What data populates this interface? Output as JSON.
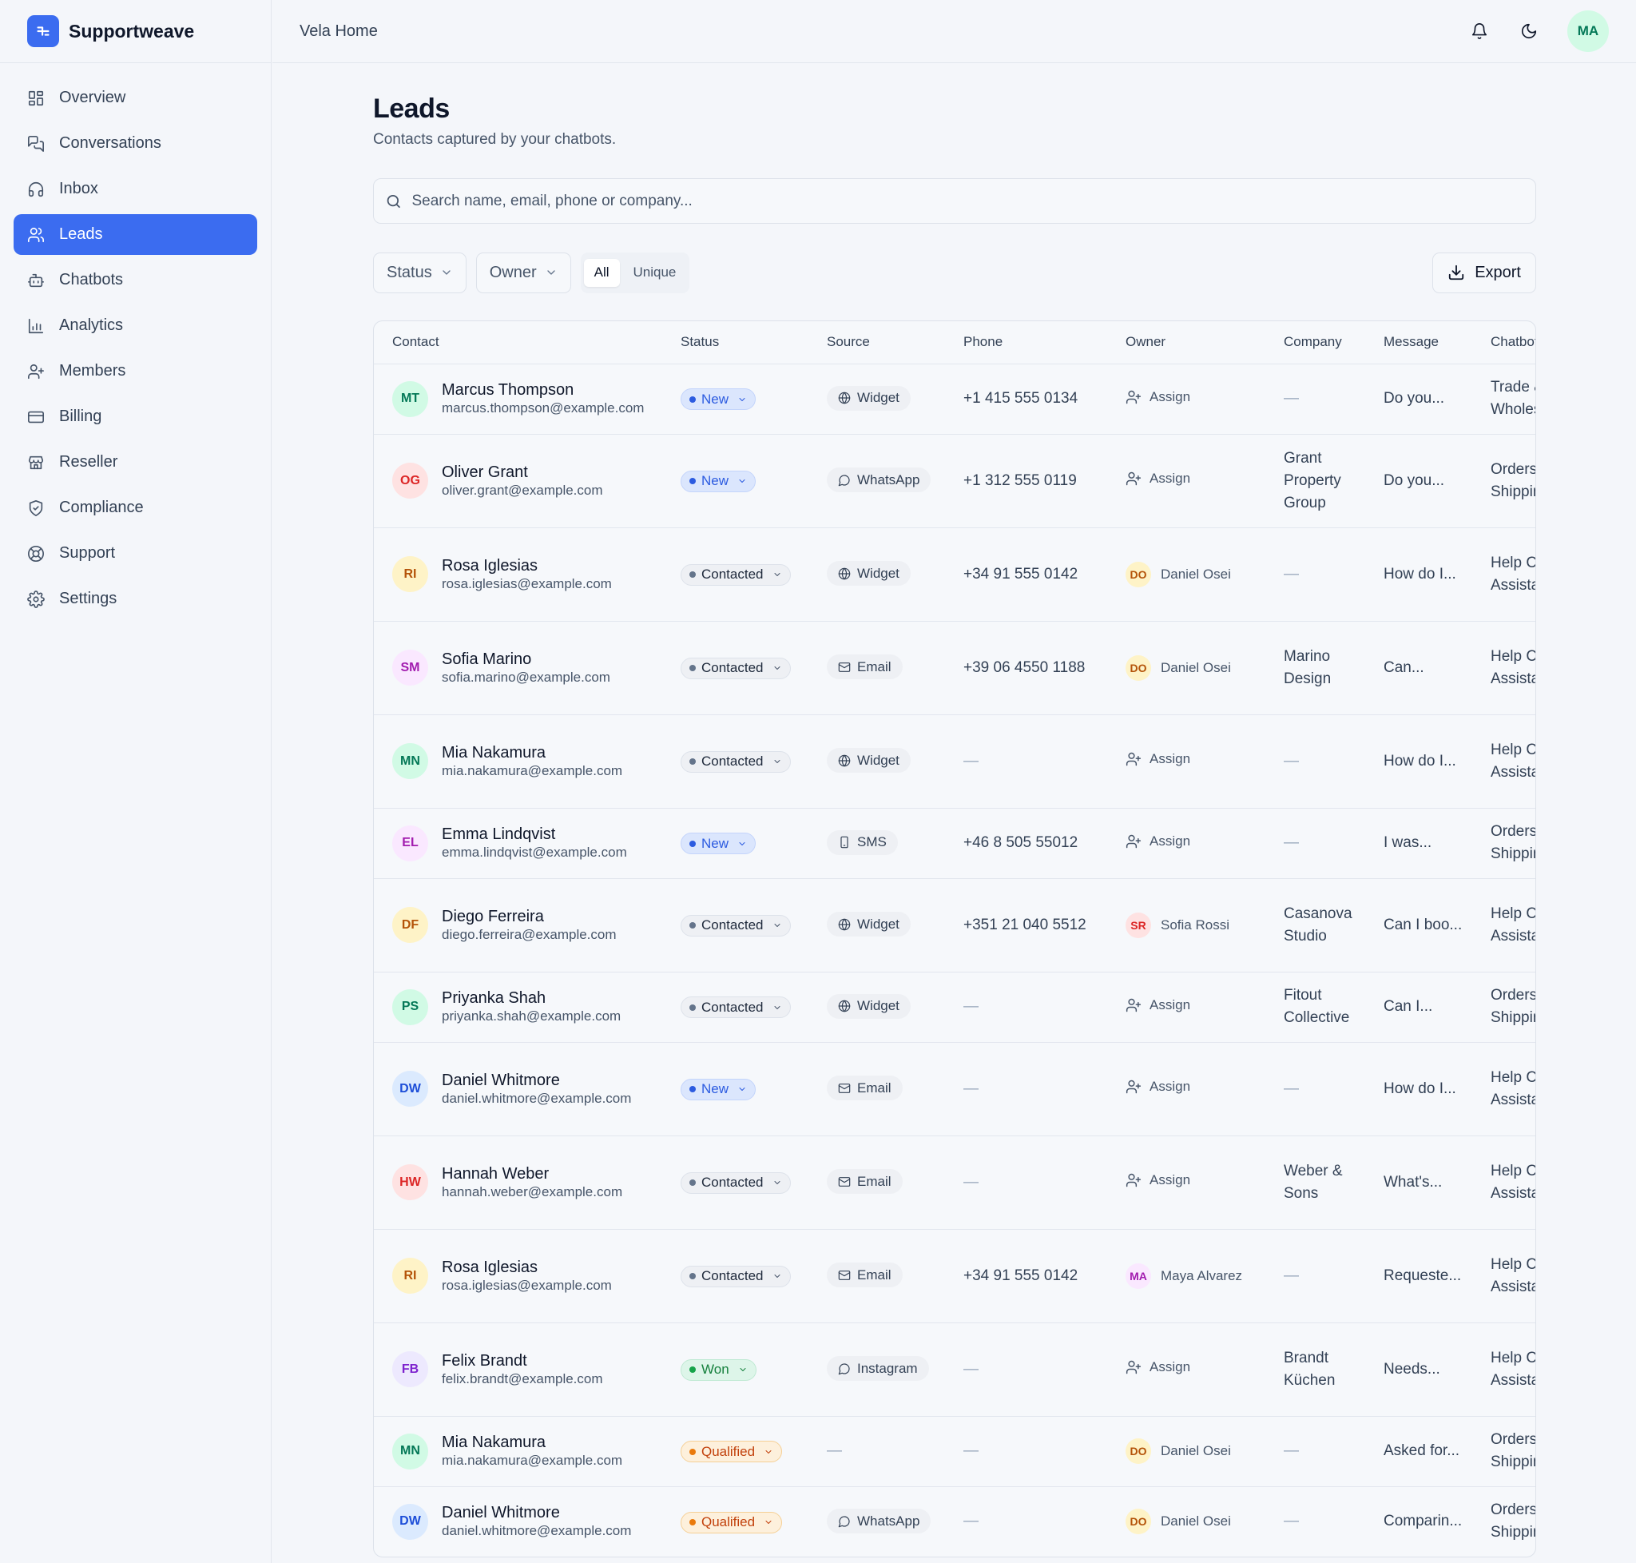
{
  "brand": {
    "name": "Supportweave"
  },
  "header": {
    "workspace": "Vela Home",
    "user_initials": "MA"
  },
  "nav": [
    {
      "label": "Overview",
      "icon": "grid-icon",
      "active": false
    },
    {
      "label": "Conversations",
      "icon": "chat-icon",
      "active": false
    },
    {
      "label": "Inbox",
      "icon": "headset-icon",
      "active": false
    },
    {
      "label": "Leads",
      "icon": "users-icon",
      "active": true
    },
    {
      "label": "Chatbots",
      "icon": "bot-icon",
      "active": false
    },
    {
      "label": "Analytics",
      "icon": "bar-chart-icon",
      "active": false
    },
    {
      "label": "Members",
      "icon": "user-plus-icon",
      "active": false
    },
    {
      "label": "Billing",
      "icon": "credit-card-icon",
      "active": false
    },
    {
      "label": "Reseller",
      "icon": "store-icon",
      "active": false
    },
    {
      "label": "Compliance",
      "icon": "shield-icon",
      "active": false
    },
    {
      "label": "Support",
      "icon": "lifebuoy-icon",
      "active": false
    },
    {
      "label": "Settings",
      "icon": "gear-icon",
      "active": false
    }
  ],
  "page": {
    "title": "Leads",
    "subtitle": "Contacts captured by your chatbots."
  },
  "search": {
    "placeholder": "Search name, email, phone or company..."
  },
  "filters": {
    "status_label": "Status",
    "owner_label": "Owner",
    "seg_all": "All",
    "seg_unique": "Unique",
    "export_label": "Export"
  },
  "columns": [
    "Contact",
    "Status",
    "Source",
    "Phone",
    "Owner",
    "Company",
    "Message",
    "Chatbot"
  ],
  "leads": [
    {
      "initials": "MT",
      "av": "green",
      "name": "Marcus Thompson",
      "email": "marcus.thompson@example.com",
      "status": "New",
      "source": "Widget",
      "phone": "+1 415 555 0134",
      "owner": null,
      "company": "",
      "message": "Do you...",
      "chatbot": "Trade & Wholesale"
    },
    {
      "initials": "OG",
      "av": "red",
      "name": "Oliver Grant",
      "email": "oliver.grant@example.com",
      "status": "New",
      "source": "WhatsApp",
      "phone": "+1 312 555 0119",
      "owner": null,
      "company": "Grant Property Group",
      "message": "Do you...",
      "chatbot": "Orders & Shipping"
    },
    {
      "initials": "RI",
      "av": "yellow",
      "name": "Rosa Iglesias",
      "email": "rosa.iglesias@example.com",
      "status": "Contacted",
      "source": "Widget",
      "phone": "+34 91 555 0142",
      "owner": {
        "initials": "DO",
        "name": "Daniel Osei",
        "av": "yellow"
      },
      "company": "",
      "message": "How do I...",
      "chatbot": "Help Center Assistant"
    },
    {
      "initials": "SM",
      "av": "pink",
      "name": "Sofia Marino",
      "email": "sofia.marino@example.com",
      "status": "Contacted",
      "source": "Email",
      "phone": "+39 06 4550 1188",
      "owner": {
        "initials": "DO",
        "name": "Daniel Osei",
        "av": "yellow"
      },
      "company": "Marino Design",
      "message": "Can...",
      "chatbot": "Help Center Assistant"
    },
    {
      "initials": "MN",
      "av": "green",
      "name": "Mia Nakamura",
      "email": "mia.nakamura@example.com",
      "status": "Contacted",
      "source": "Widget",
      "phone": "",
      "owner": null,
      "company": "",
      "message": "How do I...",
      "chatbot": "Help Center Assistant"
    },
    {
      "initials": "EL",
      "av": "pink",
      "name": "Emma Lindqvist",
      "email": "emma.lindqvist@example.com",
      "status": "New",
      "source": "SMS",
      "phone": "+46 8 505 55012",
      "owner": null,
      "company": "",
      "message": "I was...",
      "chatbot": "Orders & Shipping"
    },
    {
      "initials": "DF",
      "av": "yellow",
      "name": "Diego Ferreira",
      "email": "diego.ferreira@example.com",
      "status": "Contacted",
      "source": "Widget",
      "phone": "+351 21 040 5512",
      "owner": {
        "initials": "SR",
        "name": "Sofia Rossi",
        "av": "red"
      },
      "company": "Casanova Studio",
      "message": "Can I boo...",
      "chatbot": "Help Center Assistant"
    },
    {
      "initials": "PS",
      "av": "green",
      "name": "Priyanka Shah",
      "email": "priyanka.shah@example.com",
      "status": "Contacted",
      "source": "Widget",
      "phone": "",
      "owner": null,
      "company": "Fitout Collective",
      "message": "Can I...",
      "chatbot": "Orders & Shipping"
    },
    {
      "initials": "DW",
      "av": "blue",
      "name": "Daniel Whitmore",
      "email": "daniel.whitmore@example.com",
      "status": "New",
      "source": "Email",
      "phone": "",
      "owner": null,
      "company": "",
      "message": "How do I...",
      "chatbot": "Help Center Assistant"
    },
    {
      "initials": "HW",
      "av": "red",
      "name": "Hannah Weber",
      "email": "hannah.weber@example.com",
      "status": "Contacted",
      "source": "Email",
      "phone": "",
      "owner": null,
      "company": "Weber & Sons",
      "message": "What's...",
      "chatbot": "Help Center Assistant"
    },
    {
      "initials": "RI",
      "av": "yellow",
      "name": "Rosa Iglesias",
      "email": "rosa.iglesias@example.com",
      "status": "Contacted",
      "source": "Email",
      "phone": "+34 91 555 0142",
      "owner": {
        "initials": "MA",
        "name": "Maya Alvarez",
        "av": "pink"
      },
      "company": "",
      "message": "Requeste...",
      "chatbot": "Help Center Assistant"
    },
    {
      "initials": "FB",
      "av": "purple",
      "name": "Felix Brandt",
      "email": "felix.brandt@example.com",
      "status": "Won",
      "source": "Instagram",
      "phone": "",
      "owner": null,
      "company": "Brandt Küchen",
      "message": "Needs...",
      "chatbot": "Help Center Assistant"
    },
    {
      "initials": "MN",
      "av": "green",
      "name": "Mia Nakamura",
      "email": "mia.nakamura@example.com",
      "status": "Qualified",
      "source": "",
      "phone": "",
      "owner": {
        "initials": "DO",
        "name": "Daniel Osei",
        "av": "yellow"
      },
      "company": "",
      "message": "Asked for...",
      "chatbot": "Orders & Shipping"
    },
    {
      "initials": "DW",
      "av": "blue",
      "name": "Daniel Whitmore",
      "email": "daniel.whitmore@example.com",
      "status": "Qualified",
      "source": "WhatsApp",
      "phone": "",
      "owner": {
        "initials": "DO",
        "name": "Daniel Osei",
        "av": "yellow"
      },
      "company": "",
      "message": "Comparin...",
      "chatbot": "Orders & Shipping"
    }
  ],
  "labels": {
    "assign": "Assign",
    "empty": "—"
  },
  "colors": {
    "accent": "#3b6cf0",
    "new": "#2c5be0",
    "won": "#16a34a",
    "qualified": "#ea7a0c"
  }
}
